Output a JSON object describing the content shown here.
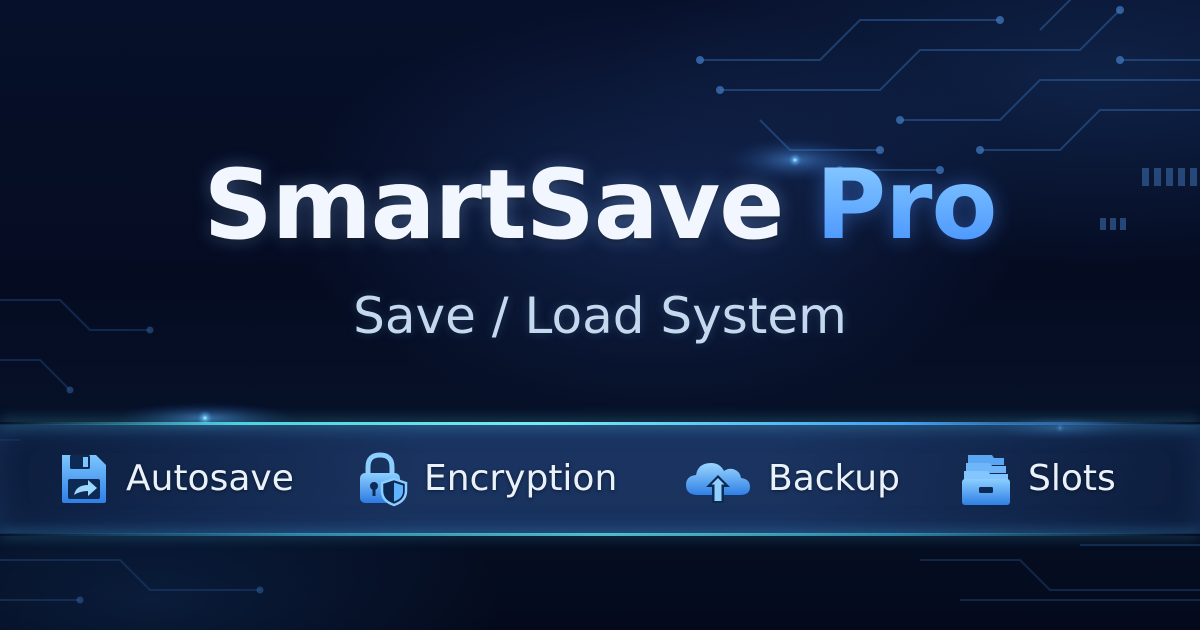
{
  "banner": {
    "title_main": "SmartSave",
    "title_accent": "Pro",
    "subtitle": "Save / Load System",
    "features": [
      {
        "label": "Autosave",
        "icon": "floppy-disk-arrow-icon"
      },
      {
        "label": "Encryption",
        "icon": "padlock-shield-icon"
      },
      {
        "label": "Backup",
        "icon": "cloud-upload-icon"
      },
      {
        "label": "Slots",
        "icon": "file-drawer-icon"
      }
    ]
  },
  "colors": {
    "background": "#050b1d",
    "title": "#f2f6ff",
    "accent": "#4a95ff",
    "subtitle": "#c4d9ee",
    "glow_line": "#5fdde6",
    "icon_blue": "#3f9cff"
  }
}
